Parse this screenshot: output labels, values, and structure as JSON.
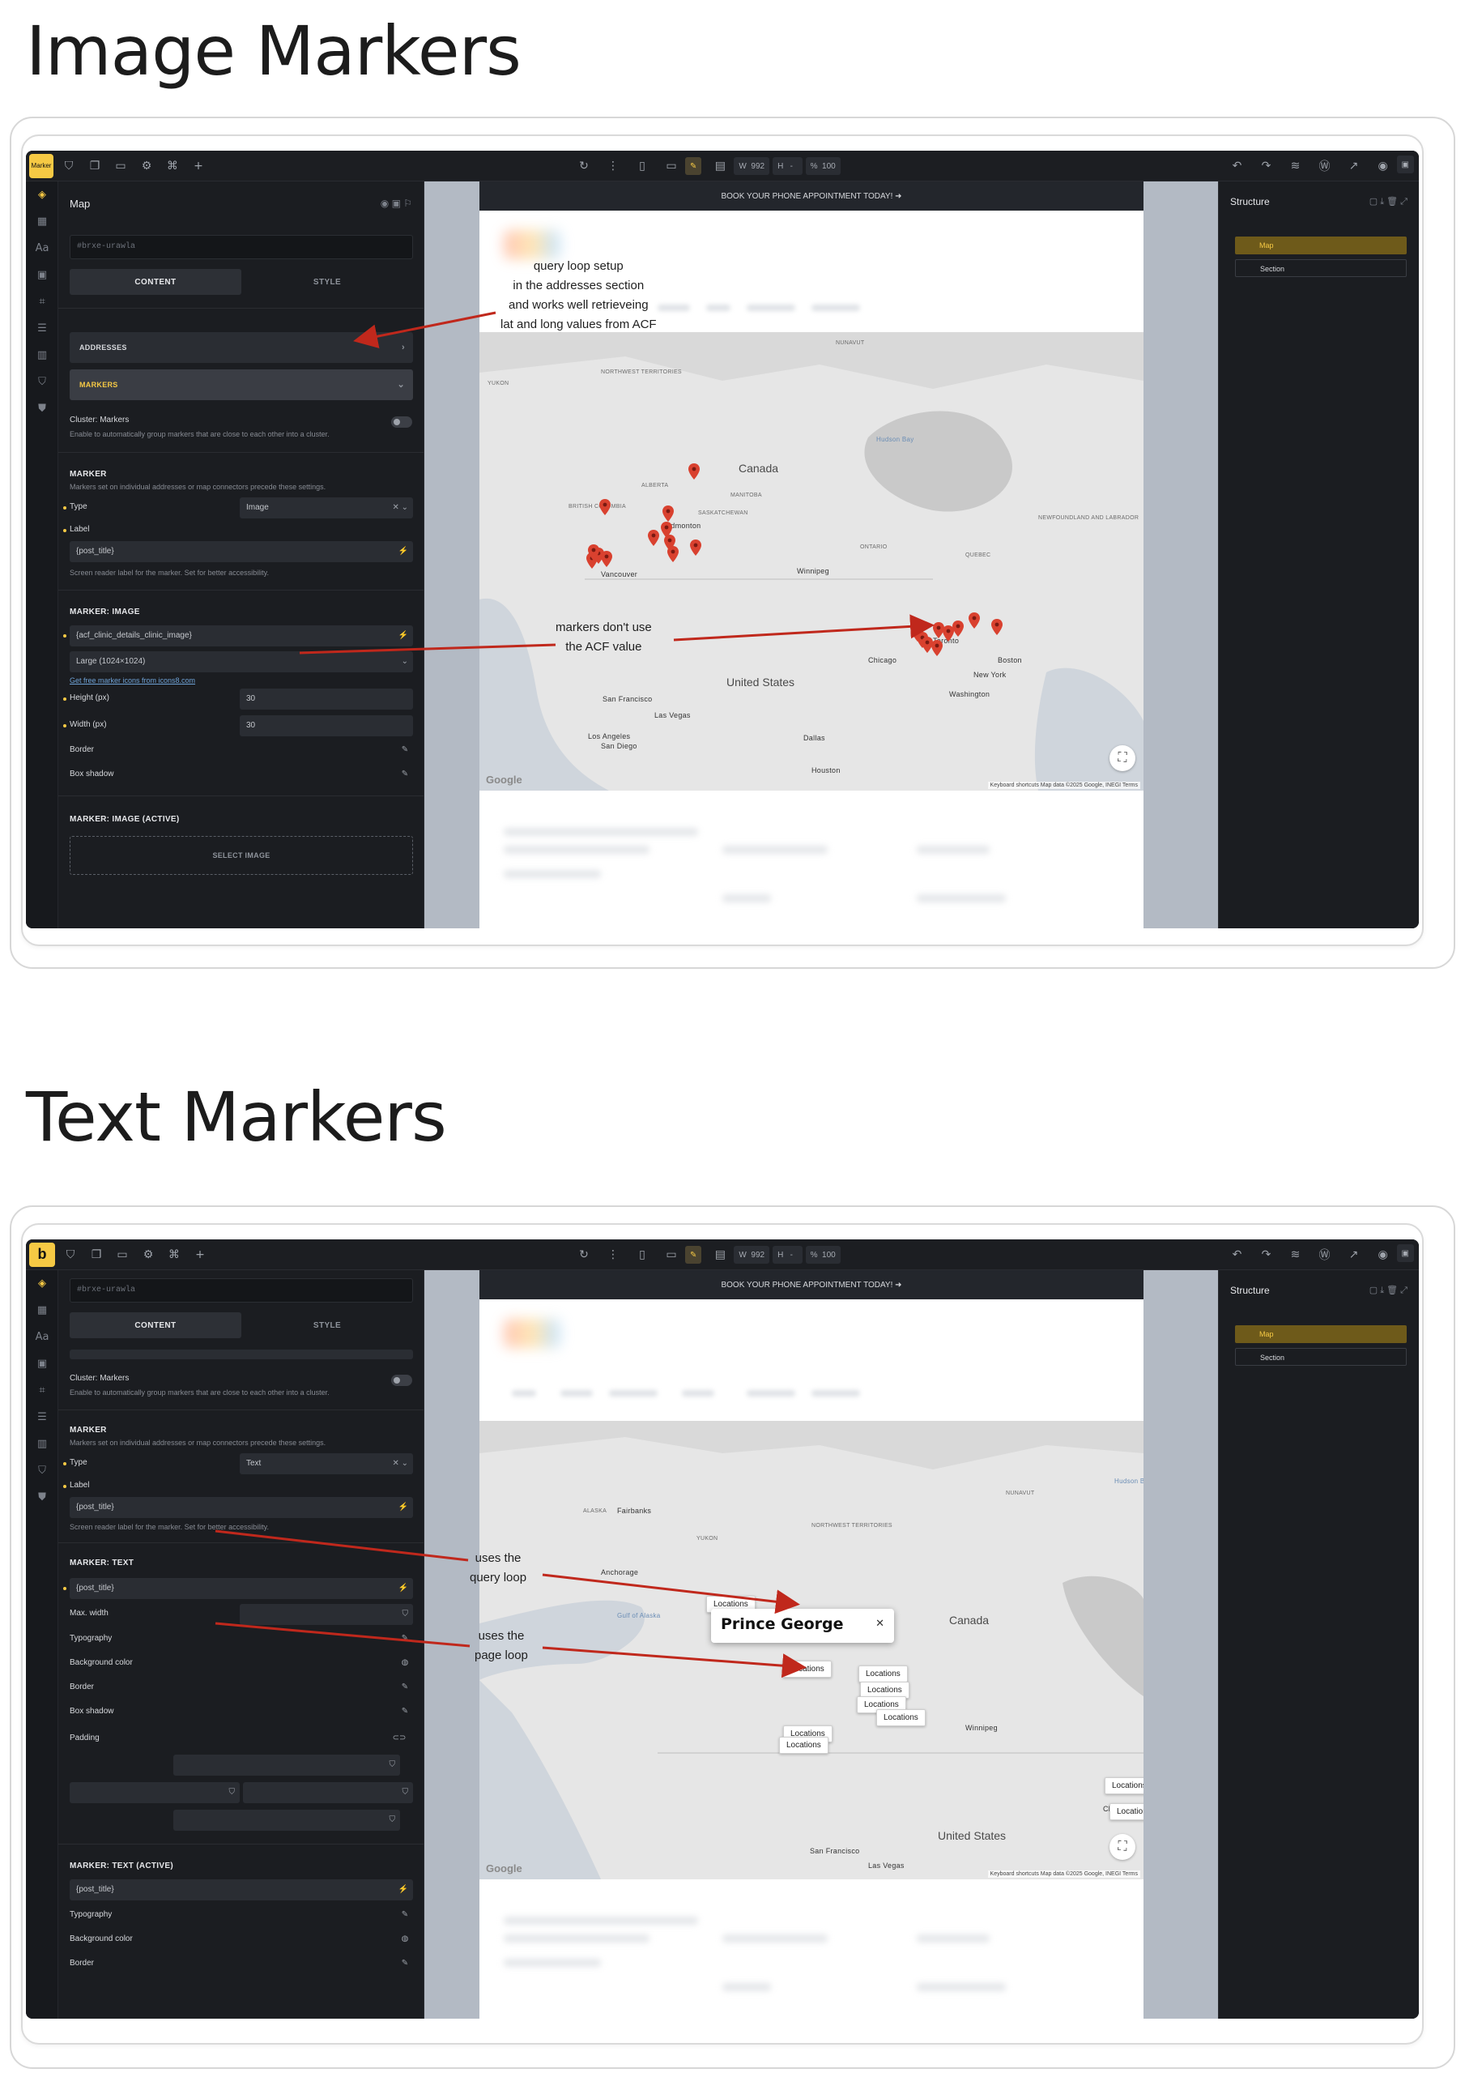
{
  "sections": {
    "image_title": "Image Markers",
    "text_title": "Text Markers"
  },
  "colors": {
    "accent": "#f6c944",
    "arrow": "#c0281c",
    "marker": "#d9412f"
  },
  "toolbar": {
    "logo": "b",
    "marker_badge": "Marker",
    "width_label": "W",
    "width_value": "992",
    "height_label": "H",
    "height_value": "-",
    "zoom_label": "%",
    "zoom_value": "100"
  },
  "site": {
    "banner": "BOOK YOUR PHONE APPOINTMENT TODAY! ➜"
  },
  "structure": {
    "title": "Structure",
    "items": [
      "Map",
      "Section"
    ]
  },
  "panel1": {
    "title": "Map",
    "id_value": "#brxe-urawla",
    "tabs": [
      "CONTENT",
      "STYLE"
    ],
    "addresses": "ADDRESSES",
    "markers": "MARKERS",
    "cluster_label": "Cluster: Markers",
    "cluster_desc": "Enable to automatically group markers that are close to each other into a cluster.",
    "marker_heading": "MARKER",
    "marker_desc": "Markers set on individual addresses or map connectors precede these settings.",
    "type_label": "Type",
    "type_value": "Image",
    "label_label": "Label",
    "label_value": "{post_title}",
    "label_help": "Screen reader label for the marker. Set for better accessibility.",
    "image_heading": "MARKER: IMAGE",
    "image_value": "{acf_clinic_details_clinic_image}",
    "size_value": "Large (1024×1024)",
    "icons_link": "Get free marker icons from icons8.com",
    "height_label": "Height (px)",
    "height_value": "30",
    "width_label": "Width (px)",
    "width_value": "30",
    "border_label": "Border",
    "shadow_label": "Box shadow",
    "image_active_heading": "MARKER: IMAGE (ACTIVE)",
    "select_image": "SELECT IMAGE"
  },
  "panel2": {
    "id_value": "#brxe-urawla",
    "tabs": [
      "CONTENT",
      "STYLE"
    ],
    "cluster_label": "Cluster: Markers",
    "cluster_desc": "Enable to automatically group markers that are close to each other into a cluster.",
    "marker_heading": "MARKER",
    "marker_desc": "Markers set on individual addresses or map connectors precede these settings.",
    "type_label": "Type",
    "type_value": "Text",
    "label_label": "Label",
    "label_value": "{post_title}",
    "label_help": "Screen reader label for the marker. Set for better accessibility.",
    "text_heading": "MARKER: TEXT",
    "text_value": "{post_title}",
    "maxwidth_label": "Max. width",
    "typography_label": "Typography",
    "bg_label": "Background color",
    "border_label": "Border",
    "shadow_label": "Box shadow",
    "padding_label": "Padding",
    "text_active_heading": "MARKER: TEXT (ACTIVE)",
    "active_value": "{post_title}",
    "typo2": "Typography",
    "bg2": "Background color",
    "border2": "Border"
  },
  "map1": {
    "labels": {
      "canada": "Canada",
      "us": "United States",
      "hudson": "Hudson Bay",
      "nunavut": "NUNAVUT",
      "nwt": "NORTHWEST TERRITORIES",
      "yukon": "YUKON",
      "alberta": "ALBERTA",
      "bc": "BRITISH COLUMBIA",
      "sask": "SASKATCHEWAN",
      "manitoba": "MANITOBA",
      "ontario": "ONTARIO",
      "quebec": "QUEBEC",
      "nl": "NEWFOUNDLAND AND LABRADOR",
      "winnipeg": "Winnipeg",
      "edmonton": "Edmonton",
      "vancouver": "Vancouver",
      "toronto": "Toronto",
      "chicago": "Chicago",
      "boston": "Boston",
      "newyork": "New York",
      "washington": "Washington",
      "sf": "San Francisco",
      "lasvegas": "Las Vegas",
      "la": "Los Angeles",
      "sandiego": "San Diego",
      "dallas": "Dallas",
      "houston": "Houston",
      "google": "Google",
      "attrib": "Keyboard shortcuts   Map data ©2025 Google, INEGI   Terms"
    }
  },
  "map2": {
    "labels": {
      "canada": "Canada",
      "us": "United States",
      "hudson": "Hudson Bay",
      "nunavut": "NUNAVUT",
      "nwt": "NORTHWEST TERRITORIES",
      "yukon": "YUKON",
      "alaska": "ALASKA",
      "fairbanks": "Fairbanks",
      "anchorage": "Anchorage",
      "gulf": "Gulf of Alaska",
      "winnipeg": "Winnipeg",
      "chicago": "Chicago",
      "sf": "San Francisco",
      "lasvegas": "Las Vegas",
      "google": "Google",
      "attrib": "Keyboard shortcuts   Map data ©2025 Google, INEGI   Terms"
    },
    "popup_title": "Prince George",
    "popup_close": "✕",
    "marker_text": "Locations"
  },
  "annotations": {
    "a1": "query loop setup\nin the addresses section\nand works well retrieveing\nlat and long values from ACF",
    "a2": "markers don't use\nthe ACF value",
    "a3": "uses the\nquery loop",
    "a4": "uses the\npage loop"
  }
}
